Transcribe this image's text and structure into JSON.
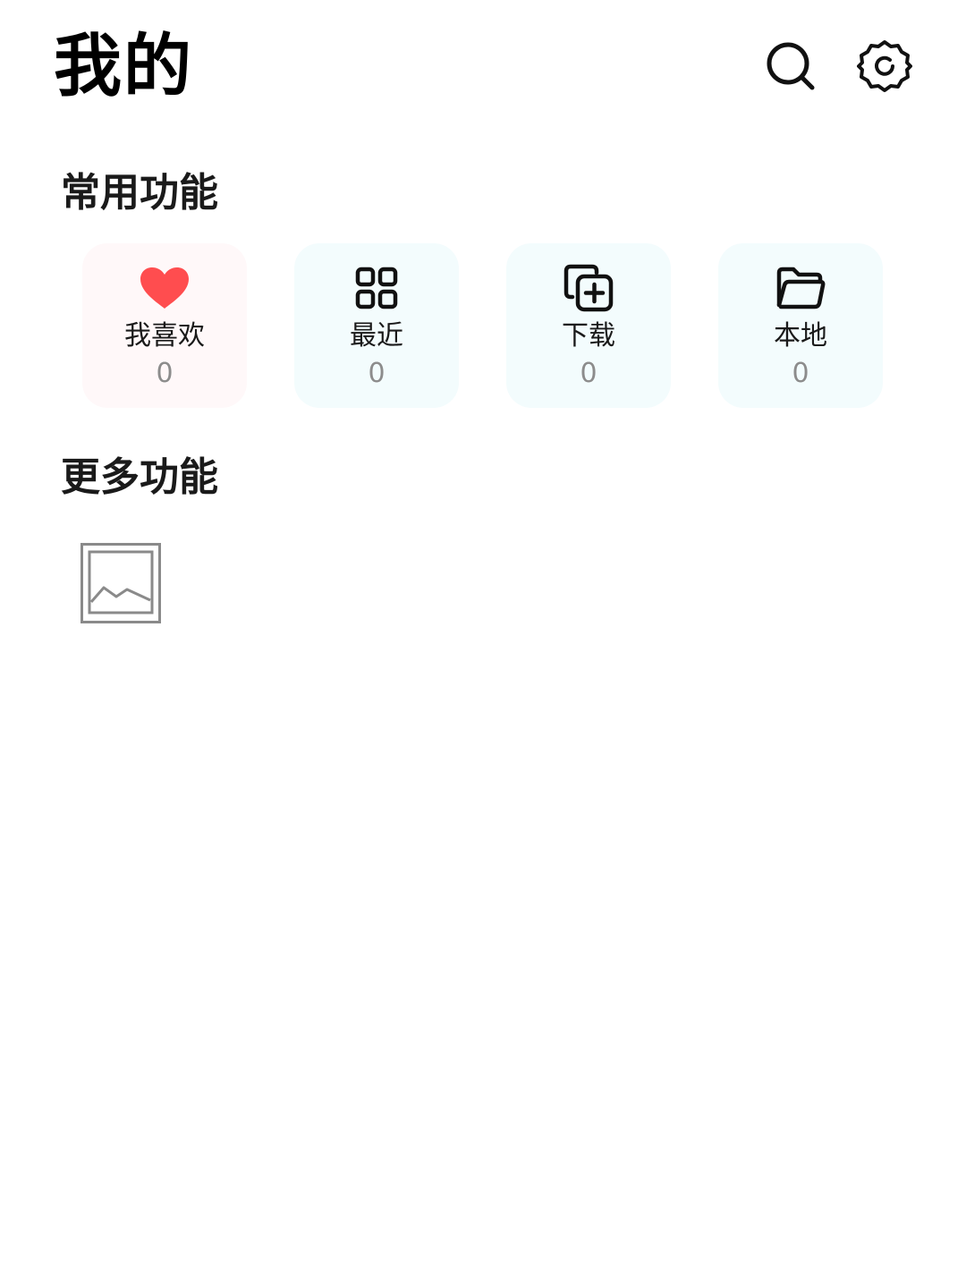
{
  "header": {
    "title": "我的",
    "search_icon": "search-icon",
    "settings_icon": "gear-icon"
  },
  "sections": {
    "common": {
      "title": "常用功能",
      "items": [
        {
          "label": "我喜欢",
          "count": "0",
          "icon": "heart-icon",
          "color": "#ff4d4f"
        },
        {
          "label": "最近",
          "count": "0",
          "icon": "grid-icon"
        },
        {
          "label": "下载",
          "count": "0",
          "icon": "add-copy-icon"
        },
        {
          "label": "本地",
          "count": "0",
          "icon": "folder-icon"
        }
      ]
    },
    "more": {
      "title": "更多功能",
      "items": [
        {
          "icon": "image-placeholder-icon"
        }
      ]
    }
  },
  "colors": {
    "heart": "#ff4d4f",
    "count_text": "#8c8c8c",
    "card_pink": "#fff8f9",
    "card_cyan": "#f3fcfd"
  }
}
